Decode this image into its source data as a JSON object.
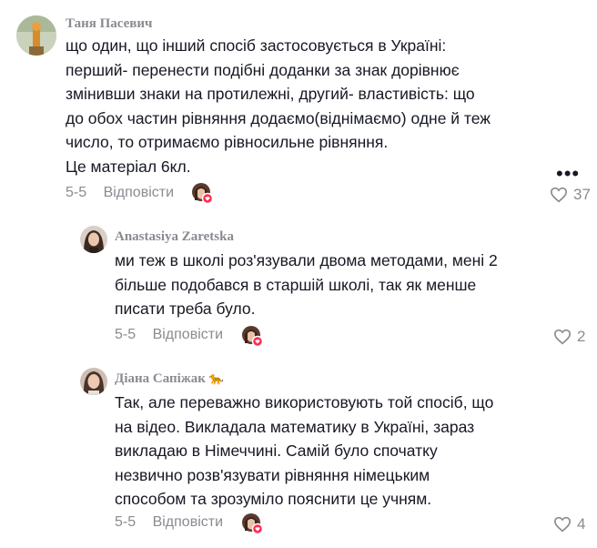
{
  "comments": [
    {
      "username": "Таня Пасевич",
      "text": "що один, що інший спосіб застосовується в Україні:\nперший- перенести подібні доданки за знак дорівнює\nзмінивши знаки на протилежні, другий- властивість: що\nдо обох частин рівняння додаємо(віднімаємо) одне й теж\nчисло, то отримаємо рівносильне рівняння.\nЦе матеріал 6кл.",
      "date": "5-5",
      "reply_label": "Відповісти",
      "likes": "37"
    },
    {
      "username": "Anastasiya Zaretska",
      "text": "ми теж в школі роз'язували двома методами, мені 2\nбільше подобався в старшій школі, так як менше\nписати треба було.",
      "date": "5-5",
      "reply_label": "Відповісти",
      "likes": "2"
    },
    {
      "username": "Діана Сапіжак",
      "username_emoji": "🐆",
      "text": "Так, але переважно використовують той спосіб, що\nна відео. Викладала математику в Україні, зараз\nвикладаю в Німеччині. Самій було спочатку\nнезвично розв'язувати рівняння німецьким\nспособом та зрозуміло пояснити це учням.",
      "date": "5-5",
      "reply_label": "Відповісти",
      "likes": "4"
    }
  ],
  "icons": {
    "more": "more-options-icon",
    "like": "heart-outline-icon",
    "creator": "creator-liked-badge"
  },
  "colors": {
    "text": "#161823",
    "muted": "#8a8b91",
    "badge": "#fe2c55"
  }
}
